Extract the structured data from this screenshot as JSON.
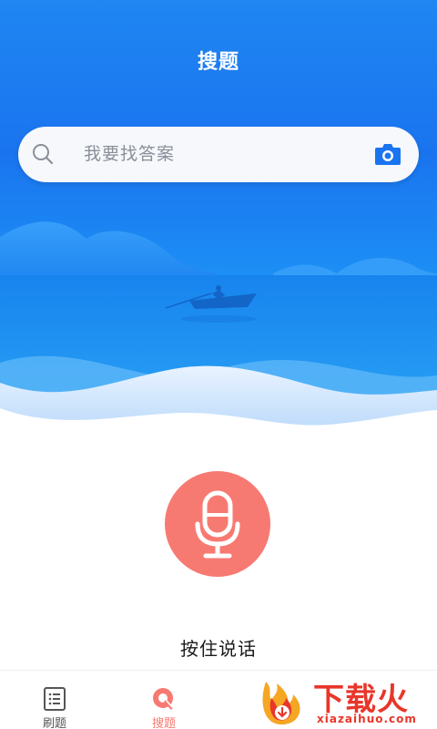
{
  "header": {
    "title": "搜题"
  },
  "search": {
    "placeholder": "我要找答案",
    "icon": "search-icon",
    "camera_icon": "camera-icon"
  },
  "voice": {
    "mic_icon": "microphone-icon",
    "label": "按住说话",
    "button_color": "#f77a72"
  },
  "tabs": [
    {
      "label": "刷题",
      "icon": "list-document-icon",
      "active": false
    },
    {
      "label": "搜题",
      "icon": "search-tab-icon",
      "active": true
    }
  ],
  "watermark": {
    "title": "下载火",
    "url": "xiazaihuo.com"
  },
  "colors": {
    "hero_blue": "#1a74ef",
    "accent_red": "#f77a72",
    "camera_blue": "#1a74ef",
    "watermark_red": "#e8362a"
  }
}
